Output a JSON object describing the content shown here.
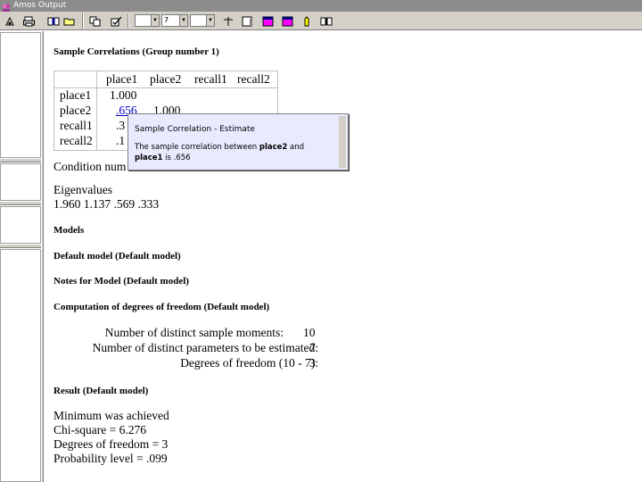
{
  "window": {
    "title": "Amos Output"
  },
  "toolbar": {
    "combo1_value": "",
    "combo2_value": "7",
    "combo3_value": ""
  },
  "output": {
    "sample_correlations": {
      "heading": "Sample Correlations (Group number 1)",
      "columns": [
        "place1",
        "place2",
        "recall1",
        "recall2"
      ],
      "rows": [
        {
          "label": "place1",
          "values": [
            "1.000"
          ]
        },
        {
          "label": "place2",
          "values": [
            ".656",
            "1.000"
          ]
        },
        {
          "label": "recall1",
          "values": [
            ".3"
          ]
        },
        {
          "label": "recall2",
          "values": [
            ".1"
          ]
        }
      ]
    },
    "condition_number_label": "Condition num",
    "eigenvalues": {
      "label": "Eigenvalues",
      "values": "1.960 1.137 .569 .333"
    },
    "models_heading": "Models",
    "default_model_heading": "Default model (Default model)",
    "notes_heading": "Notes for Model (Default model)",
    "computation_heading": "Computation of degrees of freedom (Default model)",
    "df_rows": [
      {
        "label": "Number of distinct sample moments:",
        "value": "10"
      },
      {
        "label": "Number of distinct parameters to be estimated:",
        "value": "7"
      },
      {
        "label": "Degrees of freedom (10 - 7):",
        "value": "3"
      }
    ],
    "result_heading": "Result (Default model)",
    "result_lines": [
      "Minimum was achieved",
      "Chi-square = 6.276",
      "Degrees of freedom = 3",
      "Probability level = .099"
    ]
  },
  "tooltip": {
    "title": "Sample Correlation - Estimate",
    "body_pre": "The sample correlation between ",
    "var1": "place2",
    "body_mid": " and ",
    "var2": "place1",
    "body_post": " is .656"
  }
}
